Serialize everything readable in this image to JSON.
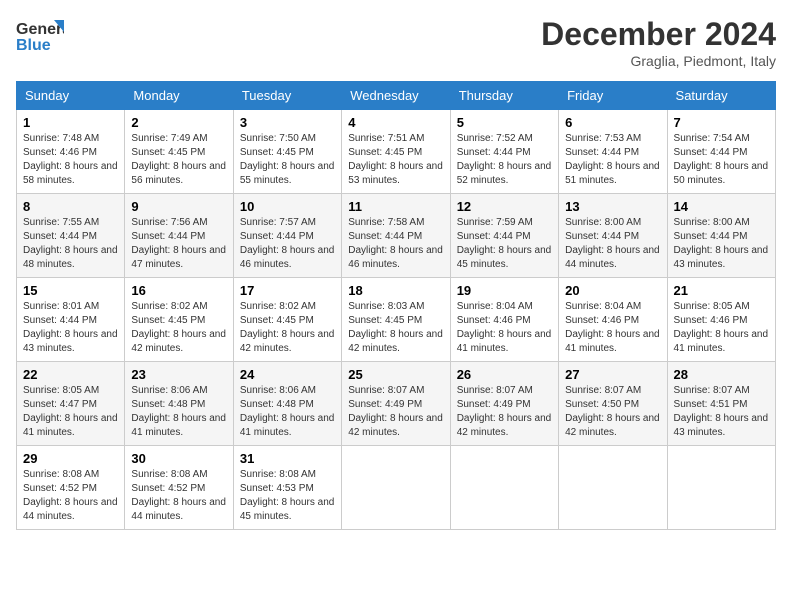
{
  "header": {
    "logo_line1": "General",
    "logo_line2": "Blue",
    "month": "December 2024",
    "location": "Graglia, Piedmont, Italy"
  },
  "days_of_week": [
    "Sunday",
    "Monday",
    "Tuesday",
    "Wednesday",
    "Thursday",
    "Friday",
    "Saturday"
  ],
  "weeks": [
    [
      {
        "day": "1",
        "sunrise": "7:48 AM",
        "sunset": "4:46 PM",
        "daylight": "8 hours and 58 minutes."
      },
      {
        "day": "2",
        "sunrise": "7:49 AM",
        "sunset": "4:45 PM",
        "daylight": "8 hours and 56 minutes."
      },
      {
        "day": "3",
        "sunrise": "7:50 AM",
        "sunset": "4:45 PM",
        "daylight": "8 hours and 55 minutes."
      },
      {
        "day": "4",
        "sunrise": "7:51 AM",
        "sunset": "4:45 PM",
        "daylight": "8 hours and 53 minutes."
      },
      {
        "day": "5",
        "sunrise": "7:52 AM",
        "sunset": "4:44 PM",
        "daylight": "8 hours and 52 minutes."
      },
      {
        "day": "6",
        "sunrise": "7:53 AM",
        "sunset": "4:44 PM",
        "daylight": "8 hours and 51 minutes."
      },
      {
        "day": "7",
        "sunrise": "7:54 AM",
        "sunset": "4:44 PM",
        "daylight": "8 hours and 50 minutes."
      }
    ],
    [
      {
        "day": "8",
        "sunrise": "7:55 AM",
        "sunset": "4:44 PM",
        "daylight": "8 hours and 48 minutes."
      },
      {
        "day": "9",
        "sunrise": "7:56 AM",
        "sunset": "4:44 PM",
        "daylight": "8 hours and 47 minutes."
      },
      {
        "day": "10",
        "sunrise": "7:57 AM",
        "sunset": "4:44 PM",
        "daylight": "8 hours and 46 minutes."
      },
      {
        "day": "11",
        "sunrise": "7:58 AM",
        "sunset": "4:44 PM",
        "daylight": "8 hours and 46 minutes."
      },
      {
        "day": "12",
        "sunrise": "7:59 AM",
        "sunset": "4:44 PM",
        "daylight": "8 hours and 45 minutes."
      },
      {
        "day": "13",
        "sunrise": "8:00 AM",
        "sunset": "4:44 PM",
        "daylight": "8 hours and 44 minutes."
      },
      {
        "day": "14",
        "sunrise": "8:00 AM",
        "sunset": "4:44 PM",
        "daylight": "8 hours and 43 minutes."
      }
    ],
    [
      {
        "day": "15",
        "sunrise": "8:01 AM",
        "sunset": "4:44 PM",
        "daylight": "8 hours and 43 minutes."
      },
      {
        "day": "16",
        "sunrise": "8:02 AM",
        "sunset": "4:45 PM",
        "daylight": "8 hours and 42 minutes."
      },
      {
        "day": "17",
        "sunrise": "8:02 AM",
        "sunset": "4:45 PM",
        "daylight": "8 hours and 42 minutes."
      },
      {
        "day": "18",
        "sunrise": "8:03 AM",
        "sunset": "4:45 PM",
        "daylight": "8 hours and 42 minutes."
      },
      {
        "day": "19",
        "sunrise": "8:04 AM",
        "sunset": "4:46 PM",
        "daylight": "8 hours and 41 minutes."
      },
      {
        "day": "20",
        "sunrise": "8:04 AM",
        "sunset": "4:46 PM",
        "daylight": "8 hours and 41 minutes."
      },
      {
        "day": "21",
        "sunrise": "8:05 AM",
        "sunset": "4:46 PM",
        "daylight": "8 hours and 41 minutes."
      }
    ],
    [
      {
        "day": "22",
        "sunrise": "8:05 AM",
        "sunset": "4:47 PM",
        "daylight": "8 hours and 41 minutes."
      },
      {
        "day": "23",
        "sunrise": "8:06 AM",
        "sunset": "4:48 PM",
        "daylight": "8 hours and 41 minutes."
      },
      {
        "day": "24",
        "sunrise": "8:06 AM",
        "sunset": "4:48 PM",
        "daylight": "8 hours and 41 minutes."
      },
      {
        "day": "25",
        "sunrise": "8:07 AM",
        "sunset": "4:49 PM",
        "daylight": "8 hours and 42 minutes."
      },
      {
        "day": "26",
        "sunrise": "8:07 AM",
        "sunset": "4:49 PM",
        "daylight": "8 hours and 42 minutes."
      },
      {
        "day": "27",
        "sunrise": "8:07 AM",
        "sunset": "4:50 PM",
        "daylight": "8 hours and 42 minutes."
      },
      {
        "day": "28",
        "sunrise": "8:07 AM",
        "sunset": "4:51 PM",
        "daylight": "8 hours and 43 minutes."
      }
    ],
    [
      {
        "day": "29",
        "sunrise": "8:08 AM",
        "sunset": "4:52 PM",
        "daylight": "8 hours and 44 minutes."
      },
      {
        "day": "30",
        "sunrise": "8:08 AM",
        "sunset": "4:52 PM",
        "daylight": "8 hours and 44 minutes."
      },
      {
        "day": "31",
        "sunrise": "8:08 AM",
        "sunset": "4:53 PM",
        "daylight": "8 hours and 45 minutes."
      },
      null,
      null,
      null,
      null
    ]
  ],
  "labels": {
    "sunrise": "Sunrise:",
    "sunset": "Sunset:",
    "daylight": "Daylight:"
  }
}
